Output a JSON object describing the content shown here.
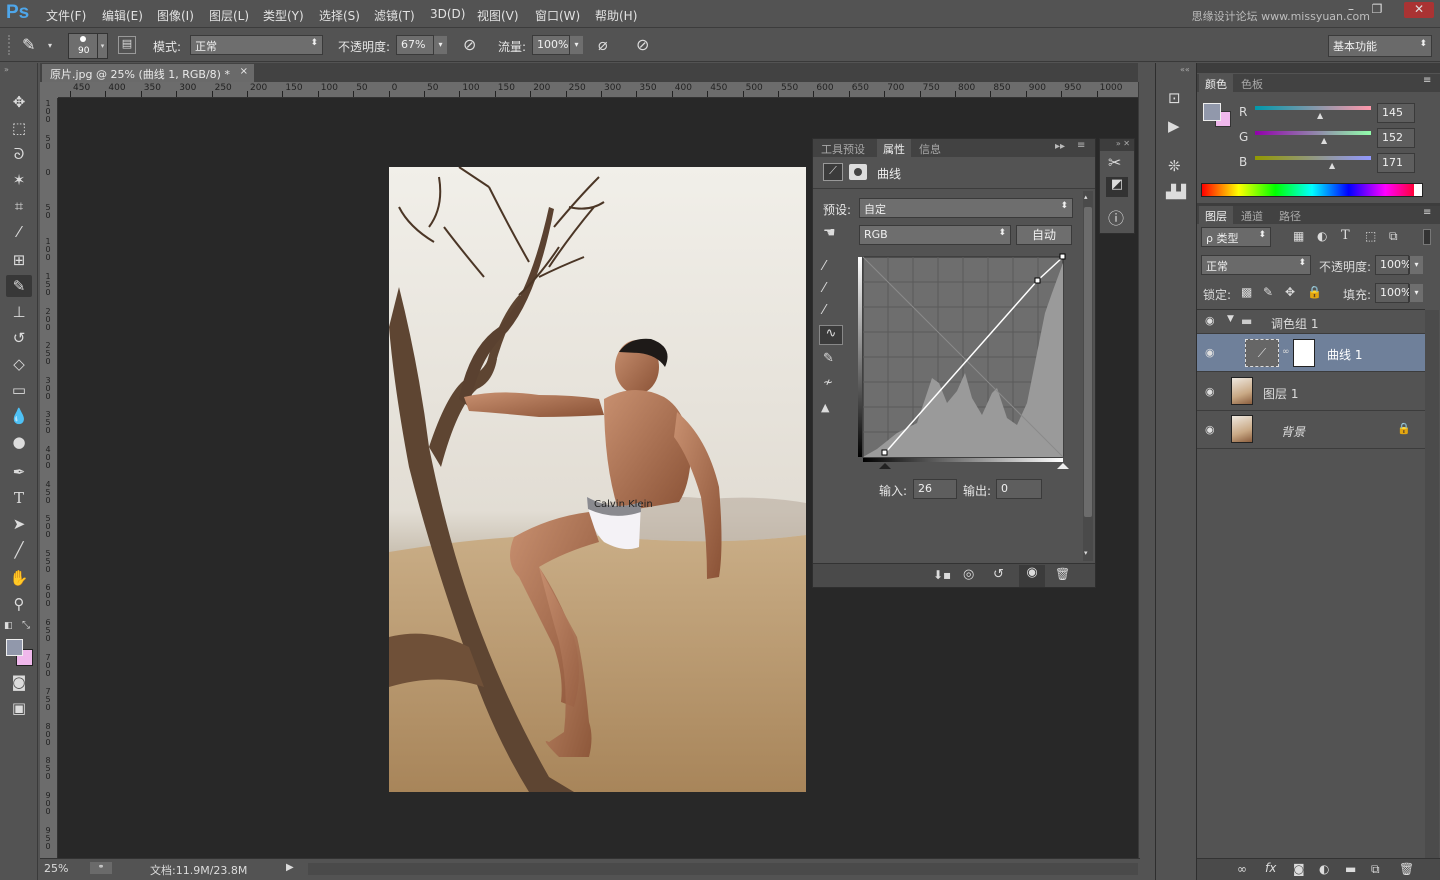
{
  "app": {
    "logo": "Ps",
    "watermark": "思缘设计论坛 www.missyuan.com"
  },
  "menu": [
    "文件(F)",
    "编辑(E)",
    "图像(I)",
    "图层(L)",
    "类型(Y)",
    "选择(S)",
    "滤镜(T)",
    "3D(D)",
    "视图(V)",
    "窗口(W)",
    "帮助(H)"
  ],
  "options": {
    "brush_size": "90",
    "mode_label": "模式:",
    "mode_value": "正常",
    "opacity_label": "不透明度:",
    "opacity_value": "67%",
    "flow_label": "流量:",
    "flow_value": "100%",
    "workspace": "基本功能"
  },
  "document": {
    "tab_title": "原片.jpg @ 25% (曲线 1, RGB/8) *",
    "ruler_top": [
      "450",
      "400",
      "350",
      "300",
      "250",
      "200",
      "150",
      "100",
      "50",
      "0",
      "50",
      "100",
      "150",
      "200",
      "250",
      "300",
      "350",
      "400",
      "450",
      "500",
      "550",
      "600",
      "650",
      "700",
      "750",
      "800",
      "850",
      "900",
      "950",
      "1000"
    ],
    "ruler_left": [
      "1 0 0",
      "5 0",
      "0",
      "5 0",
      "1 0 0",
      "1 5 0",
      "2 0 0",
      "2 5 0",
      "3 0 0",
      "3 5 0",
      "4 0 0",
      "4 5 0",
      "5 0 0",
      "5 5 0",
      "6 0 0",
      "6 5 0",
      "7 0 0",
      "7 5 0",
      "8 0 0",
      "8 5 0",
      "9 0 0",
      "9 5 0"
    ],
    "zoom": "25%",
    "doc_size": "文档:11.9M/23.8M",
    "underwear_text": "Calvin Klein"
  },
  "properties": {
    "tabs": [
      "工具预设",
      "属性",
      "信息"
    ],
    "active_tab": "属性",
    "title": "曲线",
    "preset_label": "预设:",
    "preset_value": "自定",
    "channel_value": "RGB",
    "auto_button": "自动",
    "input_label": "输入:",
    "input_value": "26",
    "output_label": "输出:",
    "output_value": "0"
  },
  "color_panel": {
    "tabs": [
      "颜色",
      "色板"
    ],
    "r_label": "R",
    "r_value": "145",
    "g_label": "G",
    "g_value": "152",
    "b_label": "B",
    "b_value": "171",
    "fg_color": "#9198ab",
    "bg_color": "#f0b8ec"
  },
  "layers_panel": {
    "tabs": [
      "图层",
      "通道",
      "路径"
    ],
    "filter_label": "ρ 类型",
    "blend_mode": "正常",
    "opacity_label": "不透明度:",
    "opacity_value": "100%",
    "lock_label": "锁定:",
    "fill_label": "填充:",
    "fill_value": "100%",
    "layers": [
      {
        "name": "调色组 1",
        "type": "group"
      },
      {
        "name": "曲线 1",
        "type": "adjustment"
      },
      {
        "name": "图层 1",
        "type": "pixel"
      },
      {
        "name": "背景",
        "type": "background"
      }
    ]
  }
}
